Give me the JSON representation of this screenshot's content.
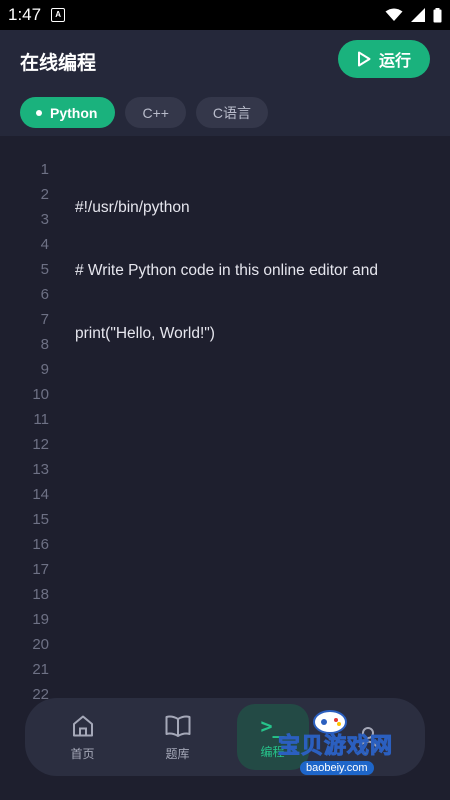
{
  "status_bar": {
    "time": "1:47"
  },
  "header": {
    "title": "在线编程",
    "run_label": "运行",
    "tabs": [
      {
        "label": "Python",
        "active": true
      },
      {
        "label": "C++",
        "active": false
      },
      {
        "label": "C语言",
        "active": false
      }
    ]
  },
  "editor": {
    "line_numbers": [
      "1",
      "2",
      "3",
      "4",
      "5",
      "6",
      "7",
      "8",
      "9",
      "10",
      "11",
      "12",
      "13",
      "14",
      "15",
      "16",
      "17",
      "18",
      "19",
      "20",
      "21",
      "22"
    ],
    "code_lines": [
      "#!/usr/bin/python",
      "# Write Python code in this online editor and",
      "print(\"Hello, World!\")"
    ]
  },
  "bottom_nav": {
    "items": [
      {
        "label": "首页",
        "icon": "home-icon",
        "active": false
      },
      {
        "label": "题库",
        "icon": "book-icon",
        "active": false
      },
      {
        "label": "编程",
        "icon": "terminal-icon",
        "active": true
      }
    ]
  },
  "watermark": {
    "text": "宝贝游戏网",
    "url": "baobeiy.com"
  },
  "colors": {
    "accent": "#1ab27d",
    "background": "#1e1f2e",
    "header": "#25283a"
  }
}
